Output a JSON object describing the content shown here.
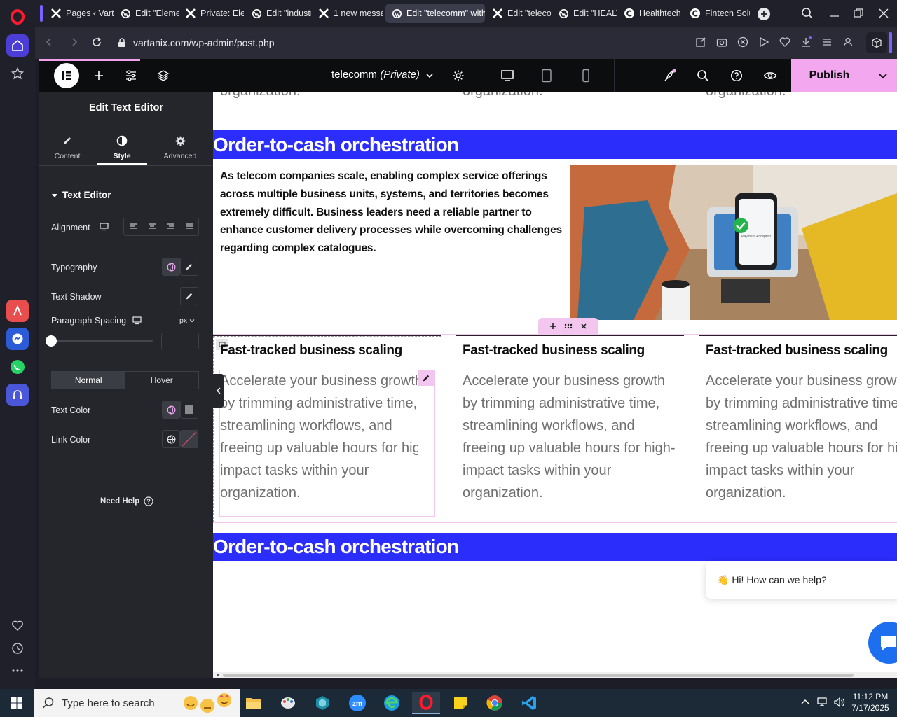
{
  "browser": {
    "tabs": [
      {
        "label": "Pages ‹ Varta",
        "icon": "x-logo-icon"
      },
      {
        "label": "Edit \"Elemen",
        "icon": "wordpress-icon"
      },
      {
        "label": "Private: Elem",
        "icon": "x-logo-icon"
      },
      {
        "label": "Edit \"industr",
        "icon": "wordpress-icon"
      },
      {
        "label": "1 new messa",
        "icon": "x-logo-icon"
      },
      {
        "label": "Edit \"telecomm\" with",
        "icon": "wordpress-icon",
        "active": true
      },
      {
        "label": "Edit \"telecon",
        "icon": "x-logo-icon"
      },
      {
        "label": "Edit \"HEALTI",
        "icon": "wordpress-icon"
      },
      {
        "label": "Healthtech S",
        "icon": "c-logo-icon"
      },
      {
        "label": "Fintech Solu",
        "icon": "c-logo-icon"
      }
    ],
    "url": "vartanix.com/wp-admin/post.php"
  },
  "topbar": {
    "page_title": "telecomm",
    "page_status": "(Private)",
    "publish_label": "Publish"
  },
  "panel": {
    "title": "Edit Text Editor",
    "tabs": [
      {
        "label": "Content",
        "icon": "pencil-icon"
      },
      {
        "label": "Style",
        "icon": "contrast-icon",
        "active": true
      },
      {
        "label": "Advanced",
        "icon": "gear-icon"
      }
    ],
    "section_title": "Text Editor",
    "alignment_label": "Alignment",
    "typography_label": "Typography",
    "text_shadow_label": "Text Shadow",
    "paragraph_spacing_label": "Paragraph Spacing",
    "paragraph_spacing_unit": "px",
    "paragraph_spacing_value": "",
    "normal_label": "Normal",
    "hover_label": "Hover",
    "text_color_label": "Text Color",
    "link_color_label": "Link Color",
    "need_help_label": "Need Help"
  },
  "canvas": {
    "top_overflow_text": "organization.",
    "heading_1": "Order-to-cash orchestration",
    "intro_lines": [
      "As telecom companies scale, enabling complex service offerings",
      "across multiple business units, systems, and territories becomes",
      "extremely difficult. Business leaders need a reliable partner to",
      "enhance customer delivery processes while overcoming challenges",
      "regarding complex catalogues."
    ],
    "columns": [
      {
        "title": "Fast-tracked business scaling",
        "lines": [
          "Accelerate your business growth",
          "by trimming administrative time,",
          "streamlining workflows, and",
          "freeing up valuable hours for high-",
          "impact tasks within your",
          "organization."
        ]
      },
      {
        "title": "Fast-tracked business scaling",
        "lines": [
          "Accelerate your business growth",
          "by trimming administrative time,",
          "streamlining workflows, and",
          "freeing up valuable hours for high-",
          "impact tasks within your",
          "organization."
        ]
      },
      {
        "title": "Fast-tracked business scaling",
        "lines": [
          "Accelerate your business growth",
          "by trimming administrative time,",
          "streamlining workflows, and",
          "freeing up valuable hours for high-",
          "impact tasks within your",
          "organization."
        ]
      }
    ],
    "heading_2": "Order-to-cash orchestration",
    "chat_bubble": "👋 Hi! How can we help?",
    "image_badge_text": "Payment Accepted"
  },
  "taskbar": {
    "search_placeholder": "Type here to search",
    "time": "11:12 PM",
    "date": "7/17/2025"
  },
  "colors": {
    "accent_pink": "#f2a7ee",
    "heading_blue": "#2b2dfb",
    "panel_bg": "#25262b"
  }
}
